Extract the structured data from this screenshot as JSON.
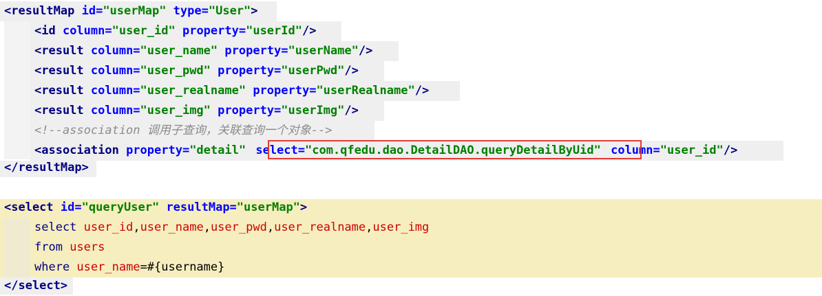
{
  "code": {
    "line1": {
      "open": "<resultMap ",
      "a1": "id=",
      "v1": "\"userMap\"",
      "a2": " type=",
      "v2": "\"User\"",
      "close": ">"
    },
    "line2": {
      "open": "<id ",
      "a1": "column=",
      "v1": "\"user_id\"",
      "a2": " property=",
      "v2": "\"userId\"",
      "close": "/>"
    },
    "line3": {
      "open": "<result ",
      "a1": "column=",
      "v1": "\"user_name\"",
      "a2": " property=",
      "v2": "\"userName\"",
      "close": "/>"
    },
    "line4": {
      "open": "<result ",
      "a1": "column=",
      "v1": "\"user_pwd\"",
      "a2": " property=",
      "v2": "\"userPwd\"",
      "close": "/>"
    },
    "line5": {
      "open": "<result ",
      "a1": "column=",
      "v1": "\"user_realname\"",
      "a2": " property=",
      "v2": "\"userRealname\"",
      "close": "/>"
    },
    "line6": {
      "open": "<result ",
      "a1": "column=",
      "v1": "\"user_img\"",
      "a2": " property=",
      "v2": "\"userImg\"",
      "close": "/>"
    },
    "line7": {
      "comment": "<!--association 调用子查询，关联查询一个对象-->"
    },
    "line8": {
      "open": "<association ",
      "a1": "property=",
      "v1": "\"detail\"",
      "sel_attr": "select=",
      "sel_val": "\"com.qfedu.dao.DetailDAO.queryDetailByUid\"",
      "a3": " column=",
      "v3": "\"user_id\"",
      "close": "/>"
    },
    "line9": {
      "close": "</resultMap>"
    },
    "line11": {
      "open": "<select ",
      "a1": "id=",
      "v1": "\"queryUser\"",
      "a2": " resultMap=",
      "v2": "\"userMap\"",
      "close": ">"
    },
    "line12": {
      "kw": "select ",
      "cols": [
        "user_id",
        "user_name",
        "user_pwd",
        "user_realname",
        "user_img"
      ]
    },
    "line13": {
      "kw": "from ",
      "table": "users"
    },
    "line14": {
      "kw": "where ",
      "col": "user_name",
      "rest": "=#{username}"
    },
    "line15": {
      "close": "</select>"
    }
  },
  "colors": {
    "tag": "#000080",
    "attribute": "#0000ff",
    "value": "#008000",
    "comment": "#8c8c8c",
    "sql_column": "#cc0000",
    "highlight_border": "#e53935",
    "sql_background": "#f7eebf"
  }
}
